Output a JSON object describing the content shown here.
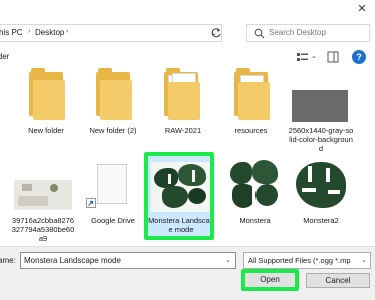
{
  "window": {
    "close_glyph": "✕"
  },
  "address": {
    "crumbs": [
      "his PC",
      "Desktop"
    ],
    "separator": "›",
    "dropdown": "⌄"
  },
  "search": {
    "placeholder": "Search Desktop"
  },
  "toolbar": {
    "label": "lder",
    "help": "?"
  },
  "items": [
    {
      "label": "New folder",
      "kind": "folder"
    },
    {
      "label": "New folder (2)",
      "kind": "folder"
    },
    {
      "label": "RAW-2021",
      "kind": "folder"
    },
    {
      "label": "resources",
      "kind": "folder"
    },
    {
      "label": "2560x1440-gray-solid-color-background",
      "kind": "gray-image"
    },
    {
      "label": "39716a2cbba8276327794a5380be60a9",
      "kind": "room-image"
    },
    {
      "label": "Google Drive",
      "kind": "shortcut"
    },
    {
      "label": "Monstera Landscape mode",
      "kind": "monstera",
      "selected": true
    },
    {
      "label": "Monstera",
      "kind": "monstera"
    },
    {
      "label": "Monstera2",
      "kind": "monstera-single"
    }
  ],
  "bottom": {
    "file_name_label": "ame:",
    "file_name_value": "Monstera Landscape mode",
    "file_type": "All Supported Files (*.ogg *.mp",
    "open_label": "Open",
    "cancel_label": "Cancel",
    "dropdown": "⌄"
  },
  "colors": {
    "highlight": "#1de94a",
    "selection": "#cce8ff",
    "folder": "#f3cb68"
  }
}
